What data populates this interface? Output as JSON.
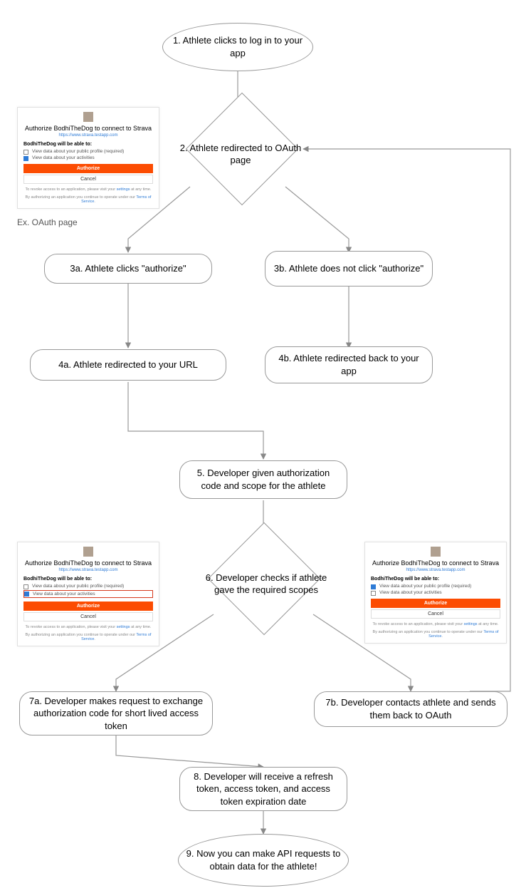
{
  "nodes": {
    "n1": "1. Athlete clicks to log in to your app",
    "n2": "2. Athlete redirected to OAuth page",
    "n3a": "3a. Athlete clicks \"authorize\"",
    "n3b": "3b. Athlete does not click \"authorize\"",
    "n4a": "4a. Athlete redirected to your URL",
    "n4b": "4b. Athlete redirected back to your app",
    "n5": "5. Developer given authorization code and scope for the athlete",
    "n6": "6. Developer checks if athlete gave the required scopes",
    "n7a": "7a. Developer makes request to exchange authorization code for short lived access token",
    "n7b": "7b. Developer contacts athlete and sends them back to OAuth",
    "n8": "8. Developer will receive a refresh token, access token, and access token expiration date",
    "n9": "9. Now you can make API requests to obtain data for the athlete!"
  },
  "caption": "Ex. OAuth page",
  "oauth": {
    "title": "Authorize BodhiTheDog to connect to Strava",
    "url": "https://www.strava.testapp.com",
    "ability_heading": "BodhiTheDog will be able to:",
    "perm_profile": "View data about your public profile (required)",
    "perm_activities": "View data about your activities",
    "authorize_btn": "Authorize",
    "cancel_btn": "Cancel",
    "revoke_pre": "To revoke access to an application, please visit your ",
    "revoke_link": "settings",
    "revoke_post": " at any time.",
    "tos_pre": "By authorizing an application you continue to operate under our ",
    "tos_link": "Terms of Service",
    "tos_post": "."
  }
}
